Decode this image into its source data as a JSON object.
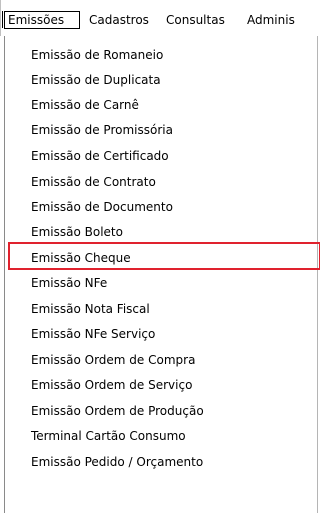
{
  "menubar": {
    "items": [
      {
        "label": "Emissões"
      },
      {
        "label": "Cadastros"
      },
      {
        "label": "Consultas"
      },
      {
        "label": "Adminis"
      }
    ]
  },
  "dropdown": {
    "items": [
      {
        "label": "Emissão de Romaneio"
      },
      {
        "label": "Emissão de Duplicata"
      },
      {
        "label": "Emissão de Carnê"
      },
      {
        "label": "Emissão de Promissória"
      },
      {
        "label": "Emissão de Certificado"
      },
      {
        "label": "Emissão de Contrato"
      },
      {
        "label": "Emissão de Documento"
      },
      {
        "label": "Emissão Boleto"
      },
      {
        "label": "Emissão Cheque"
      },
      {
        "label": "Emissão NFe"
      },
      {
        "label": "Emissão Nota Fiscal"
      },
      {
        "label": "Emissão NFe Serviço"
      },
      {
        "label": "Emissão Ordem de Compra"
      },
      {
        "label": "Emissão Ordem de Serviço"
      },
      {
        "label": "Emissão Ordem de Produção"
      },
      {
        "label": "Terminal Cartão Consumo"
      },
      {
        "label": "Emissão Pedido / Orçamento"
      }
    ],
    "highlighted_item": "Emissão NFe",
    "highlight_color": "#e0222e"
  }
}
